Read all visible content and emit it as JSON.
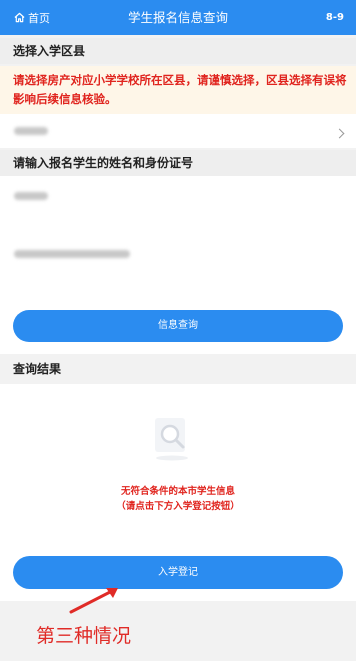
{
  "header": {
    "home_label": "首页",
    "title": "学生报名信息查询",
    "badge": "8-9"
  },
  "district": {
    "section_title": "选择入学区县",
    "notice": "请选择房产对应小学学校所在区县，请谨慎选择，区县选择有误将影响后续信息核验。"
  },
  "student": {
    "section_title": "请输入报名学生的姓名和身份证号",
    "query_button": "信息查询"
  },
  "result": {
    "section_title": "查询结果",
    "empty_line1": "无符合条件的本市学生信息",
    "empty_line2": "（请点击下方入学登记按钮）",
    "register_button": "入学登记"
  },
  "annotation": {
    "text": "第三种情况",
    "color": "#e02b27"
  },
  "icons": [
    "home-icon",
    "chevron-right-icon",
    "search-empty-icon",
    "arrow-annotation-icon"
  ],
  "colors": {
    "primary": "#2b8cf0",
    "warning_text": "#e0241e",
    "notice_bg": "#fef6e8"
  }
}
